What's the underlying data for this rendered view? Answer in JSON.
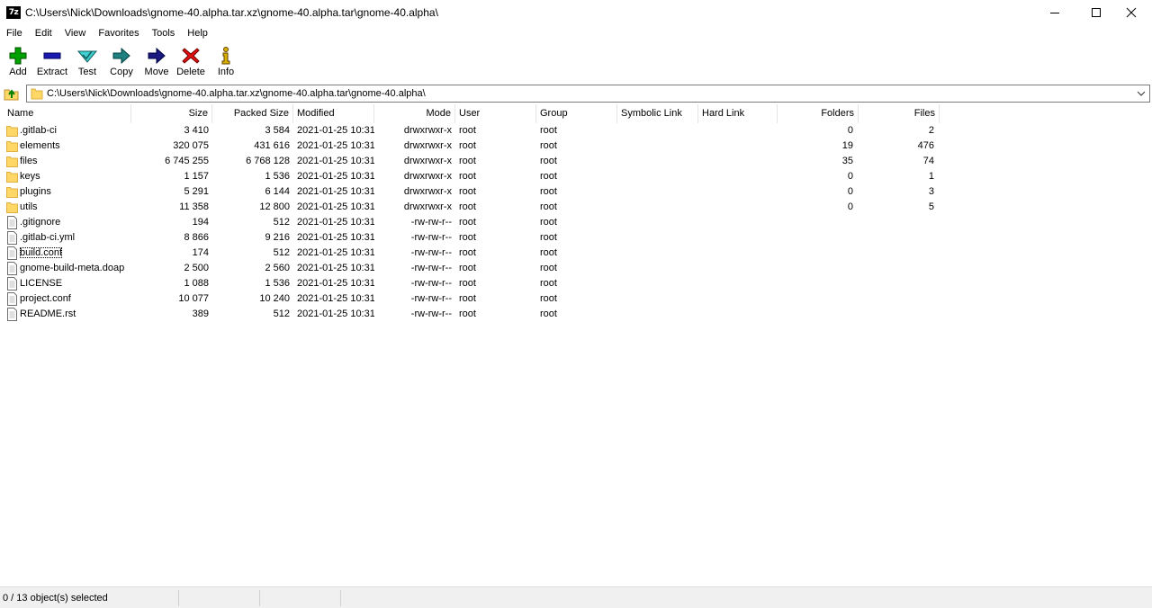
{
  "window": {
    "app_icon_text": "7z",
    "title": "C:\\Users\\Nick\\Downloads\\gnome-40.alpha.tar.xz\\gnome-40.alpha.tar\\gnome-40.alpha\\"
  },
  "menu": [
    "File",
    "Edit",
    "View",
    "Favorites",
    "Tools",
    "Help"
  ],
  "toolbar": [
    {
      "label": "Add",
      "icon": "plus-icon",
      "color": "#00a000"
    },
    {
      "label": "Extract",
      "icon": "minus-icon",
      "color": "#1a1ab0"
    },
    {
      "label": "Test",
      "icon": "check-icon",
      "color": "#20c0c0"
    },
    {
      "label": "Copy",
      "icon": "copy-arrow-icon",
      "color": "#208080"
    },
    {
      "label": "Move",
      "icon": "move-arrow-icon",
      "color": "#1a1a80"
    },
    {
      "label": "Delete",
      "icon": "x-icon",
      "color": "#e01010"
    },
    {
      "label": "Info",
      "icon": "info-icon",
      "color": "#c0a000"
    }
  ],
  "address": {
    "path": "C:\\Users\\Nick\\Downloads\\gnome-40.alpha.tar.xz\\gnome-40.alpha.tar\\gnome-40.alpha\\"
  },
  "columns": [
    "Name",
    "Size",
    "Packed Size",
    "Modified",
    "Mode",
    "User",
    "Group",
    "Symbolic Link",
    "Hard Link",
    "Folders",
    "Files"
  ],
  "rows": [
    {
      "type": "folder",
      "name": ".gitlab-ci",
      "size": "3 410",
      "packed": "3 584",
      "modified": "2021-01-25 10:31",
      "mode": "drwxrwxr-x",
      "user": "root",
      "group": "root",
      "folders": "0",
      "files": "2"
    },
    {
      "type": "folder",
      "name": "elements",
      "size": "320 075",
      "packed": "431 616",
      "modified": "2021-01-25 10:31",
      "mode": "drwxrwxr-x",
      "user": "root",
      "group": "root",
      "folders": "19",
      "files": "476"
    },
    {
      "type": "folder",
      "name": "files",
      "size": "6 745 255",
      "packed": "6 768 128",
      "modified": "2021-01-25 10:31",
      "mode": "drwxrwxr-x",
      "user": "root",
      "group": "root",
      "folders": "35",
      "files": "74"
    },
    {
      "type": "folder",
      "name": "keys",
      "size": "1 157",
      "packed": "1 536",
      "modified": "2021-01-25 10:31",
      "mode": "drwxrwxr-x",
      "user": "root",
      "group": "root",
      "folders": "0",
      "files": "1"
    },
    {
      "type": "folder",
      "name": "plugins",
      "size": "5 291",
      "packed": "6 144",
      "modified": "2021-01-25 10:31",
      "mode": "drwxrwxr-x",
      "user": "root",
      "group": "root",
      "folders": "0",
      "files": "3"
    },
    {
      "type": "folder",
      "name": "utils",
      "size": "11 358",
      "packed": "12 800",
      "modified": "2021-01-25 10:31",
      "mode": "drwxrwxr-x",
      "user": "root",
      "group": "root",
      "folders": "0",
      "files": "5"
    },
    {
      "type": "file",
      "name": ".gitignore",
      "size": "194",
      "packed": "512",
      "modified": "2021-01-25 10:31",
      "mode": "-rw-rw-r--",
      "user": "root",
      "group": "root",
      "folders": "",
      "files": ""
    },
    {
      "type": "file",
      "name": ".gitlab-ci.yml",
      "size": "8 866",
      "packed": "9 216",
      "modified": "2021-01-25 10:31",
      "mode": "-rw-rw-r--",
      "user": "root",
      "group": "root",
      "folders": "",
      "files": ""
    },
    {
      "type": "file",
      "name": "build.conf",
      "size": "174",
      "packed": "512",
      "modified": "2021-01-25 10:31",
      "mode": "-rw-rw-r--",
      "user": "root",
      "group": "root",
      "folders": "",
      "files": ""
    },
    {
      "type": "file",
      "name": "gnome-build-meta.doap",
      "size": "2 500",
      "packed": "2 560",
      "modified": "2021-01-25 10:31",
      "mode": "-rw-rw-r--",
      "user": "root",
      "group": "root",
      "folders": "",
      "files": ""
    },
    {
      "type": "file",
      "name": "LICENSE",
      "size": "1 088",
      "packed": "1 536",
      "modified": "2021-01-25 10:31",
      "mode": "-rw-rw-r--",
      "user": "root",
      "group": "root",
      "folders": "",
      "files": ""
    },
    {
      "type": "file",
      "name": "project.conf",
      "size": "10 077",
      "packed": "10 240",
      "modified": "2021-01-25 10:31",
      "mode": "-rw-rw-r--",
      "user": "root",
      "group": "root",
      "folders": "",
      "files": ""
    },
    {
      "type": "file",
      "name": "README.rst",
      "size": "389",
      "packed": "512",
      "modified": "2021-01-25 10:31",
      "mode": "-rw-rw-r--",
      "user": "root",
      "group": "root",
      "folders": "",
      "files": ""
    }
  ],
  "status": {
    "selection": "0 / 13 object(s) selected"
  },
  "colors": {
    "folder": "#ffd766",
    "folder_edge": "#e0b040",
    "status_bg": "#f0f0f0"
  }
}
